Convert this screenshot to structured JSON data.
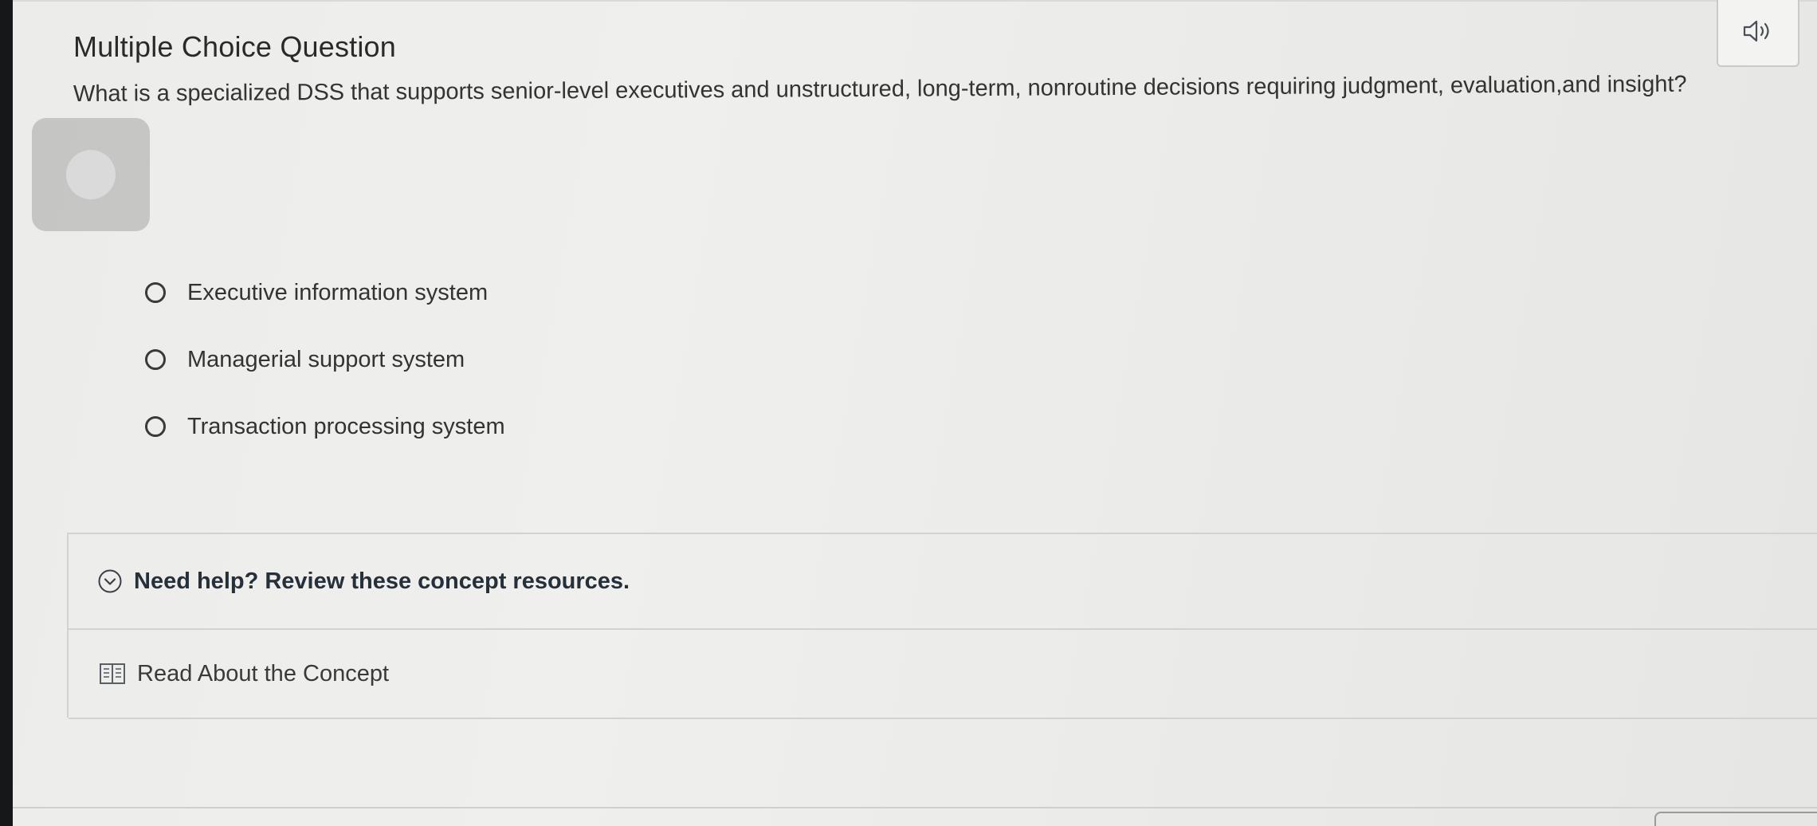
{
  "question": {
    "type_label": "Multiple Choice Question",
    "prompt": "What is a specialized DSS that supports senior-level executives and unstructured, long-term, nonroutine decisions requiring judgment, evaluation,and insight?",
    "options": [
      {
        "label": "Executive information system"
      },
      {
        "label": "Managerial support system"
      },
      {
        "label": "Transaction processing system"
      }
    ]
  },
  "help": {
    "toggle_label": "Need help? Review these concept resources.",
    "resource_label": "Read About the Concept"
  },
  "icons": {
    "audio": "speaker-icon",
    "help_toggle": "chevron-down-circle-icon",
    "resource": "book-icon"
  }
}
